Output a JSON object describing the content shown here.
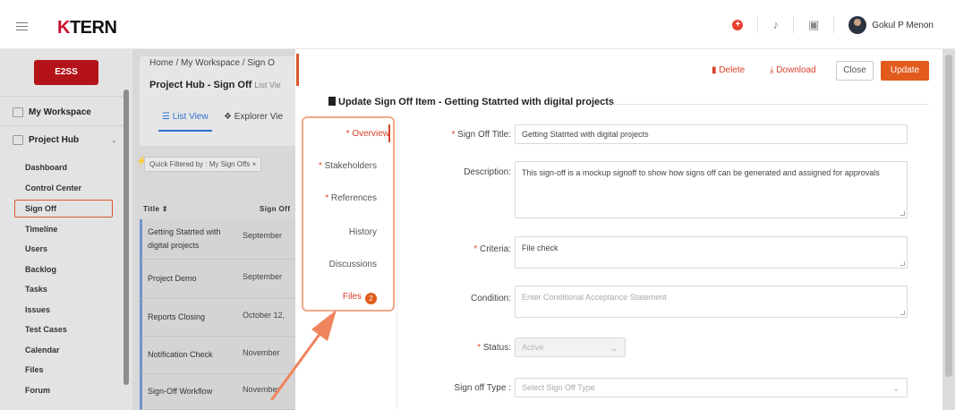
{
  "header": {
    "logo_k": "K",
    "logo_rest": "TERN",
    "username": "Gokul P Menon",
    "icons": [
      "hamburger-icon",
      "plus-circle-icon",
      "bell-icon",
      "calendar-icon",
      "avatar"
    ]
  },
  "sidebar": {
    "badge": "E2SS",
    "workspace_label": "My Workspace",
    "project_hub_label": "Project Hub",
    "items": [
      {
        "label": "Dashboard"
      },
      {
        "label": "Control Center"
      },
      {
        "label": "Sign Off"
      },
      {
        "label": "Timeline"
      },
      {
        "label": "Users"
      },
      {
        "label": "Backlog"
      },
      {
        "label": "Tasks"
      },
      {
        "label": "Issues"
      },
      {
        "label": "Test Cases"
      },
      {
        "label": "Calendar"
      },
      {
        "label": "Files"
      },
      {
        "label": "Forum"
      }
    ],
    "active_item": "Sign Off"
  },
  "background": {
    "breadcrumb": "Home  /  My Workspace  /  Sign O",
    "page_title": "Project Hub - Sign Off",
    "page_title_suffix": "List Vie",
    "tab_list_view": "List View",
    "tab_explorer_view": "Explorer Vie",
    "filter_chip": "Quick Filtered by : My Sign Offs",
    "col_title": "Title",
    "col_sign_off": "Sign Off",
    "rows": [
      {
        "title": "Getting Statrted with digital projects",
        "date": "September"
      },
      {
        "title": "Project Demo",
        "date": "September"
      },
      {
        "title": "Reports Closing",
        "date": "October 12,"
      },
      {
        "title": "Notification Check",
        "date": "November"
      },
      {
        "title": "Sign-Off Workflow",
        "date": "November"
      }
    ]
  },
  "modal": {
    "delete_label": "Delete",
    "download_label": "Download",
    "close_label": "Close",
    "update_label": "Update",
    "heading": "Update Sign Off Item - Getting Statrted with digital projects",
    "tabs": [
      {
        "label": "Overview",
        "required": true,
        "active": true
      },
      {
        "label": "Stakeholders",
        "required": true
      },
      {
        "label": "References",
        "required": true
      },
      {
        "label": "History",
        "required": false
      },
      {
        "label": "Discussions",
        "required": false
      },
      {
        "label": "Files",
        "required": false,
        "badge": "2"
      }
    ],
    "form": {
      "sign_off_title_label": "Sign Off Title:",
      "sign_off_title_value": "Getting Statrted with digital projects",
      "description_label": "Description:",
      "description_value": "This sign-off is a mockup signoff to show how signs off can be generated and assigned for approvals",
      "criteria_label": "Criteria:",
      "criteria_value": "File check",
      "condition_label": "Condition:",
      "condition_placeholder": "Enter Conditional Acceptance Statement",
      "status_label": "Status:",
      "status_value": "Active",
      "sign_off_type_label": "Sign off Type :",
      "sign_off_type_placeholder": "Select Sign Off Type"
    }
  },
  "colors": {
    "accent": "#e25a1c",
    "brand_red": "#b5131a",
    "link_blue": "#2f6fd3",
    "annotation": "#f0845c"
  }
}
